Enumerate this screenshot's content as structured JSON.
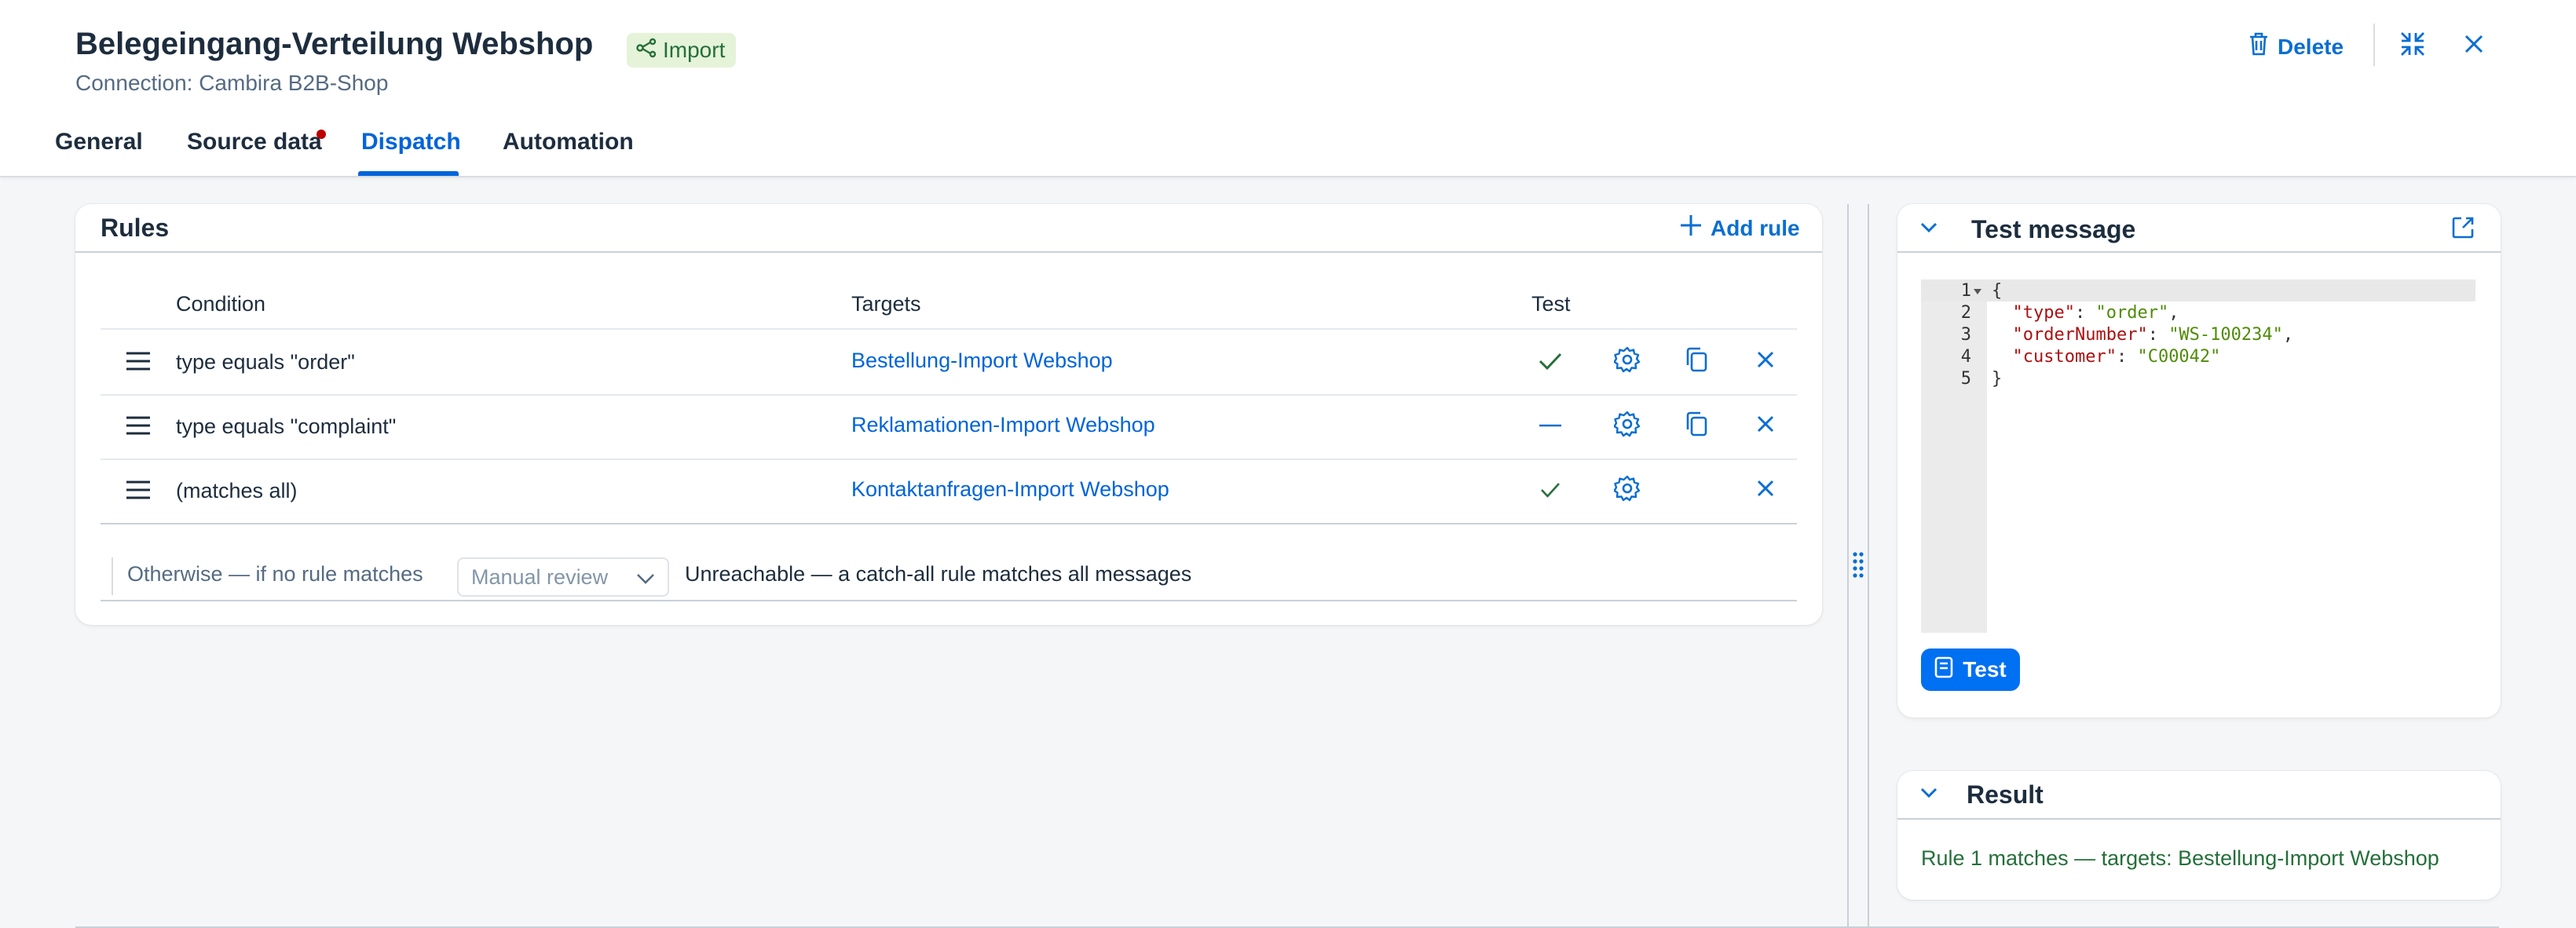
{
  "header": {
    "title": "Belegeingang-Verteilung Webshop",
    "badge": "Import",
    "subtitle": "Connection: Cambira B2B-Shop",
    "delete_label": "Delete"
  },
  "tabs": [
    {
      "label": "General"
    },
    {
      "label": "Source data"
    },
    {
      "label": "Dispatch"
    },
    {
      "label": "Automation"
    }
  ],
  "rules": {
    "title": "Rules",
    "add_label": "Add rule",
    "columns": {
      "condition": "Condition",
      "targets": "Targets",
      "test": "Test"
    },
    "rows": [
      {
        "condition": "type equals \"order\"",
        "target": "Bestellung-Import Webshop",
        "test": "pass"
      },
      {
        "condition": "type equals \"complaint\"",
        "target": "Reklamationen-Import Webshop",
        "test": "none"
      },
      {
        "condition": "(matches all)",
        "target": "Kontaktanfragen-Import Webshop",
        "test": "pass"
      }
    ],
    "otherwise_label": "Otherwise — if no rule matches",
    "otherwise_select": "Manual review",
    "otherwise_note": "Unreachable — a catch-all rule matches all messages"
  },
  "test_message": {
    "title": "Test message",
    "lines": [
      "1",
      "2",
      "3",
      "4",
      "5"
    ],
    "code": [
      "{",
      "  \"type\": \"order\",",
      "  \"orderNumber\": \"WS-100234\",",
      "  \"customer\": \"C00042\"",
      "}"
    ],
    "test_label": "Test"
  },
  "result": {
    "title": "Result",
    "text": "Rule 1 matches — targets: Bestellung-Import Webshop"
  },
  "colors": {
    "accent": "#0064d9",
    "success": "#256f3a",
    "badge_bg": "#e5f3d8",
    "required_dot": "#bb0000"
  }
}
